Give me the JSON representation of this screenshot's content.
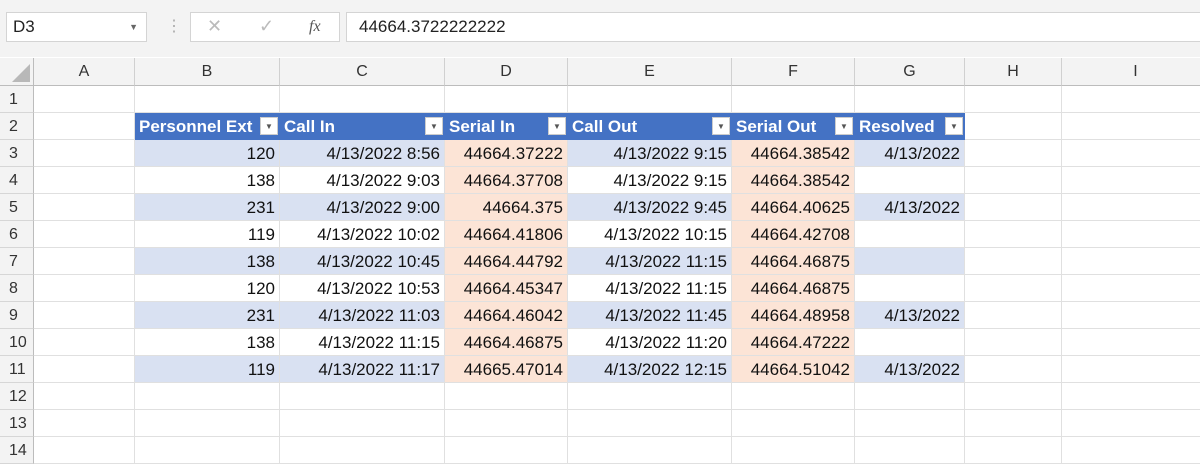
{
  "name_box": "D3",
  "formula_bar": {
    "cancel_icon": "✕",
    "enter_icon": "✓",
    "fx_label": "fx",
    "value": "44664.3722222222"
  },
  "columns": [
    "A",
    "B",
    "C",
    "D",
    "E",
    "F",
    "G",
    "H",
    "I"
  ],
  "rows": [
    "1",
    "2",
    "3",
    "4",
    "5",
    "6",
    "7",
    "8",
    "9",
    "10",
    "11",
    "12",
    "13",
    "14"
  ],
  "table": {
    "headers": [
      "Personnel Ext",
      "Call In",
      "Serial In",
      "Call Out",
      "Serial Out",
      "Resolved"
    ],
    "rows": [
      [
        "120",
        "4/13/2022 8:56",
        "44664.37222",
        "4/13/2022 9:15",
        "44664.38542",
        "4/13/2022"
      ],
      [
        "138",
        "4/13/2022 9:03",
        "44664.37708",
        "4/13/2022 9:15",
        "44664.38542",
        ""
      ],
      [
        "231",
        "4/13/2022 9:00",
        "44664.375",
        "4/13/2022 9:45",
        "44664.40625",
        "4/13/2022"
      ],
      [
        "119",
        "4/13/2022 10:02",
        "44664.41806",
        "4/13/2022 10:15",
        "44664.42708",
        ""
      ],
      [
        "138",
        "4/13/2022 10:45",
        "44664.44792",
        "4/13/2022 11:15",
        "44664.46875",
        ""
      ],
      [
        "120",
        "4/13/2022 10:53",
        "44664.45347",
        "4/13/2022 11:15",
        "44664.46875",
        ""
      ],
      [
        "231",
        "4/13/2022 11:03",
        "44664.46042",
        "4/13/2022 11:45",
        "44664.48958",
        "4/13/2022"
      ],
      [
        "138",
        "4/13/2022 11:15",
        "44664.46875",
        "4/13/2022 11:20",
        "44664.47222",
        ""
      ],
      [
        "119",
        "4/13/2022 11:17",
        "44665.47014",
        "4/13/2022 12:15",
        "44664.51042",
        "4/13/2022"
      ]
    ]
  },
  "colors": {
    "header": "#4472c4",
    "band": "#d9e1f2",
    "highlight": "#fce4d6"
  }
}
